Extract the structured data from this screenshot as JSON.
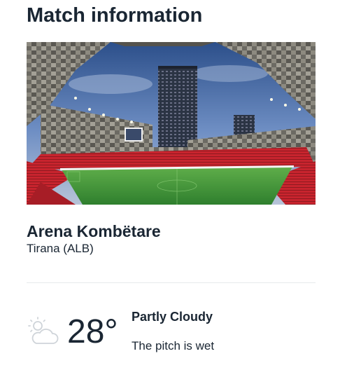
{
  "section": {
    "title": "Match information"
  },
  "venue": {
    "name": "Arena Kombëtare",
    "city": "Tirana (ALB)",
    "photo_icon": "stadium-photo"
  },
  "weather": {
    "icon": "partly-cloudy-icon",
    "temperature": "28°",
    "condition": "Partly Cloudy",
    "pitch": "The pitch is wet"
  },
  "colors": {
    "text": "#1a2633",
    "divider": "#e6e9ec",
    "seats": "#c8242e",
    "pitch": "#3f9a3a",
    "icon": "#cfd4d9"
  }
}
